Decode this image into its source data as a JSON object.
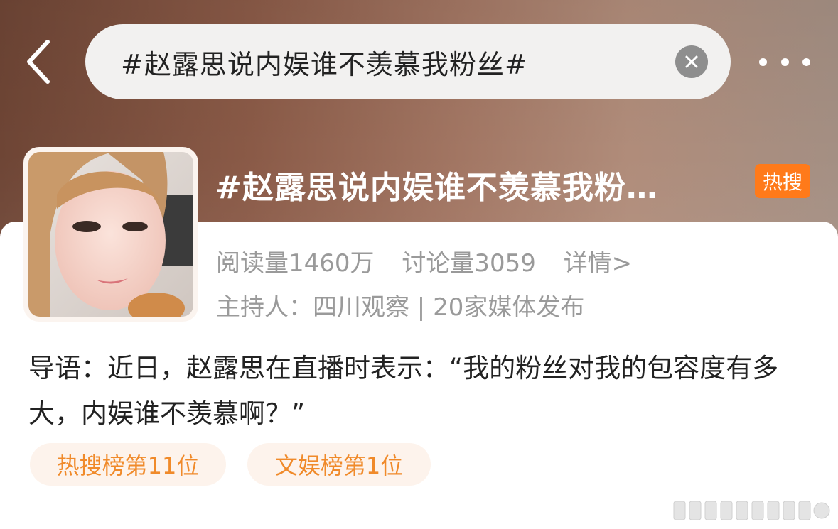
{
  "search": {
    "value": "#赵露思说内娱谁不羡慕我粉丝#"
  },
  "topic": {
    "title": "#赵露思说内娱谁不羡慕我粉…",
    "badge": "热搜",
    "reads": "阅读量1460万",
    "discussions": "讨论量3059",
    "details_link": "详情>",
    "host_line": "主持人：四川观察 | 20家媒体发布"
  },
  "intro": {
    "text": "导语：近日，赵露思在直播时表示：“我的粉丝对我的包容度有多大，内娱谁不羡慕啊？”"
  },
  "tags": [
    {
      "label": "热搜榜第11位"
    },
    {
      "label": "文娱榜第1位"
    }
  ],
  "icons": {
    "back": "chevron-left-icon",
    "clear": "close-circle-icon",
    "more": "more-horizontal-icon"
  },
  "colors": {
    "hot_badge": "#ff7a1a",
    "tag_text": "#f08a2a",
    "tag_bg": "#fdf3ec"
  }
}
